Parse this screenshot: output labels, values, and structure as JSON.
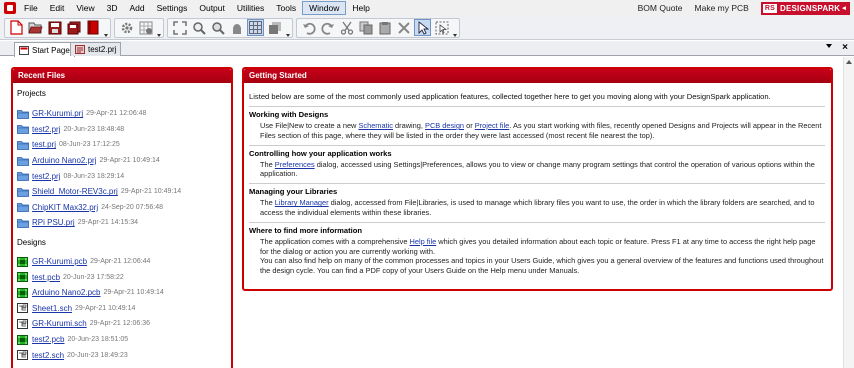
{
  "menubar": {
    "items": [
      "File",
      "Edit",
      "View",
      "3D",
      "Add",
      "Settings",
      "Output",
      "Utilities",
      "Tools",
      "Window",
      "Help"
    ],
    "active_item": "Window",
    "right_links": [
      "BOM Quote",
      "Make my PCB"
    ],
    "brand": {
      "badge": "RS",
      "text": "DESIGNSPARK"
    }
  },
  "toolbar": {
    "icons": [
      "new-file-icon",
      "open-file-icon",
      "save-icon",
      "save-all-icon",
      "book-icon",
      "settings-icon",
      "grid-settings-icon",
      "fit-view-icon",
      "zoom-in-icon",
      "zoom-out-icon",
      "pan-icon",
      "grid-icon",
      "layer-icon",
      "undo-icon",
      "redo-icon",
      "cut-icon",
      "copy-icon",
      "paste-icon",
      "delete-icon",
      "select-icon",
      "select-area-icon"
    ]
  },
  "tabs": [
    {
      "label": "Start Page",
      "active": true
    },
    {
      "label": "test2.prj",
      "active": false
    }
  ],
  "recent_files": {
    "title": "Recent Files",
    "projects_label": "Projects",
    "projects": [
      {
        "name": "GR-Kurumi.prj",
        "date": "29-Apr-21 12:06:48"
      },
      {
        "name": "test2.prj",
        "date": "20-Jun-23 18:48:48"
      },
      {
        "name": "test.prj",
        "date": "08-Jun-23 17:12:25"
      },
      {
        "name": "Arduino Nano2.prj",
        "date": "29-Apr-21 10:49:14"
      },
      {
        "name": "test2.prj",
        "date": "08-Jun-23 18:29:14"
      },
      {
        "name": "Shield_Motor-REV3c.prj",
        "date": "29-Apr-21 10:49:14"
      },
      {
        "name": "ChipKIT Max32.prj",
        "date": "24-Sep-20 07:56:48"
      },
      {
        "name": "RPi PSU.prj",
        "date": "29-Apr-21 14:15:34"
      }
    ],
    "designs_label": "Designs",
    "designs": [
      {
        "name": "GR-Kurumi.pcb",
        "date": "29-Apr-21 12:06:44",
        "kind": "pcb"
      },
      {
        "name": "test.pcb",
        "date": "20-Jun-23 17:58:22",
        "kind": "pcb"
      },
      {
        "name": "Arduino Nano2.pcb",
        "date": "29-Apr-21 10:49:14",
        "kind": "pcb"
      },
      {
        "name": "Sheet1.sch",
        "date": "29-Apr-21 10:49:14",
        "kind": "sch"
      },
      {
        "name": "GR-Kurumi.sch",
        "date": "29-Apr-21 12:06:36",
        "kind": "sch"
      },
      {
        "name": "test2.pcb",
        "date": "20-Jun-23 18:51:05",
        "kind": "pcb"
      },
      {
        "name": "test2.sch",
        "date": "20-Jun-23 18:49:23",
        "kind": "sch"
      }
    ]
  },
  "getting_started": {
    "title": "Getting Started",
    "intro": "Listed below are some of the most commonly used application features, collected together here to get you moving along with your DesignSpark application.",
    "sections": [
      {
        "heading": "Working with Designs",
        "parts": [
          {
            "t": "Use File|New to create a new "
          },
          {
            "t": "Schematic",
            "link": true
          },
          {
            "t": " drawing, "
          },
          {
            "t": "PCB design",
            "link": true
          },
          {
            "t": " or "
          },
          {
            "t": "Project file",
            "link": true
          },
          {
            "t": ". As you start working with files, recently opened Designs and Projects will appear in the Recent Files section of this page, where they will be listed in the order they were last accessed (most recent file nearest the top)."
          }
        ]
      },
      {
        "heading": "Controlling how your application works",
        "parts": [
          {
            "t": "The "
          },
          {
            "t": "Preferences",
            "link": true
          },
          {
            "t": " dialog, accessed using Settings|Preferences, allows you to view or change many program settings that control the operation of various options within the application."
          }
        ]
      },
      {
        "heading": "Managing your Libraries",
        "parts": [
          {
            "t": "The "
          },
          {
            "t": "Library Manager",
            "link": true
          },
          {
            "t": " dialog, accessed from File|Libraries, is used to manage which library files you want to use, the order in which the library folders are searched, and to access the individual elements within these libraries."
          }
        ]
      },
      {
        "heading": "Where to find more information",
        "parts": [
          {
            "t": "The application comes with a comprehensive "
          },
          {
            "t": "Help file",
            "link": true
          },
          {
            "t": " which gives you detailed information about each topic or feature. Press F1 at any time to access the right help page for the dialog or action you are currently working with."
          },
          {
            "br": true
          },
          {
            "t": "You can also find help on many of the common processes and topics in your Users Guide, which gives you a general overview of the features and functions used throughout the design cycle. You can find a PDF copy of your Users Guide on the Help menu under Manuals."
          }
        ]
      }
    ]
  },
  "colors": {
    "accent": "#c00000",
    "link": "#1a35a8",
    "brand": "#c8102e"
  }
}
